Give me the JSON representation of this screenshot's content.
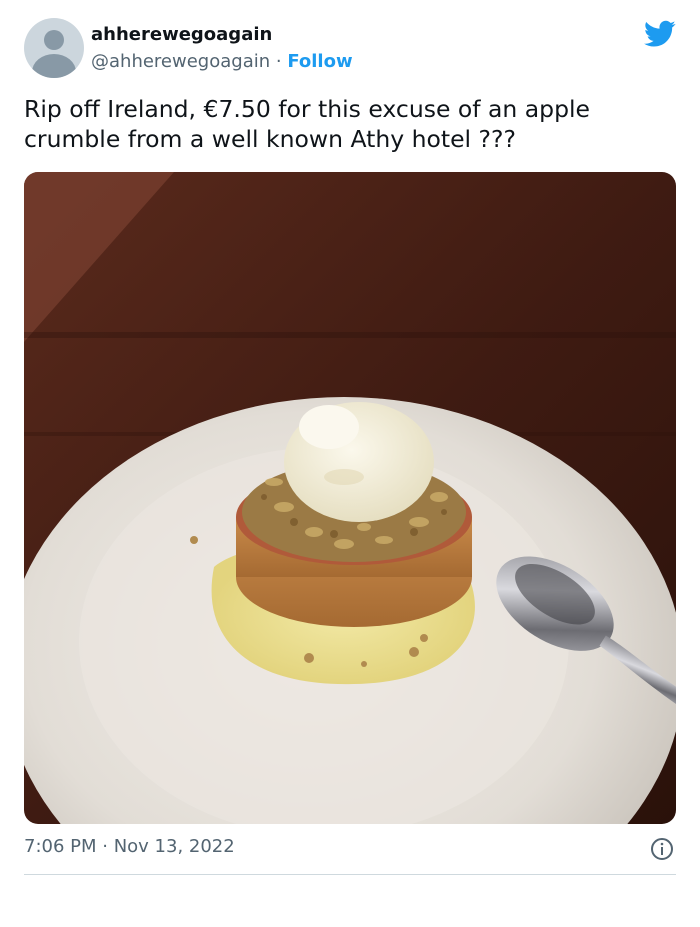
{
  "user": {
    "display_name": "ahherewegoagain",
    "handle": "@ahherewegoagain",
    "separator": " · ",
    "follow_label": "Follow"
  },
  "tweet": {
    "text": "Rip off Ireland, €7.50 for this excuse of an apple crumble from a well known Athy hotel ???",
    "timestamp": "7:06 PM · Nov 13, 2022"
  },
  "icons": {
    "brand": "twitter-bird-icon",
    "info": "info-icon"
  },
  "colors": {
    "brand_blue": "#1d9bf0",
    "text_primary": "#0f1419",
    "text_secondary": "#536471"
  }
}
